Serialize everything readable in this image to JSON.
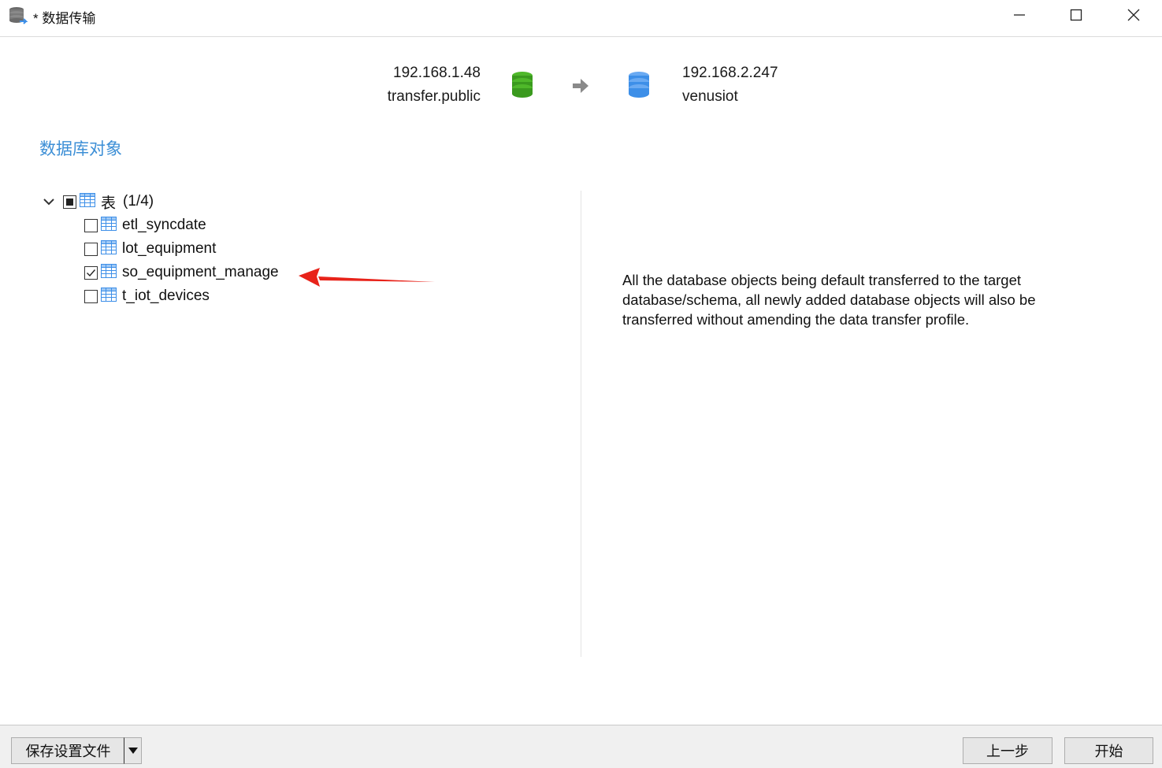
{
  "window": {
    "title": "* 数据传输",
    "app_icon": "database-transfer-icon",
    "controls": [
      "minimize-icon",
      "maximize-icon",
      "close-icon"
    ]
  },
  "connection": {
    "source": {
      "host": "192.168.1.48",
      "schema": "transfer.public",
      "icon": "database-icon",
      "color": "#3a9a1e"
    },
    "arrow_icon": "arrow-right-icon",
    "target": {
      "host": "192.168.2.247",
      "schema": "venusiot",
      "icon": "database-icon",
      "color": "#3d8fe8"
    }
  },
  "section_title": "数据库对象",
  "tree": {
    "root": {
      "label": "表",
      "count": "(1/4)",
      "state": "partial",
      "expanded": true,
      "icon": "table-icon"
    },
    "items": [
      {
        "label": "etl_syncdate",
        "checked": false,
        "icon": "table-icon"
      },
      {
        "label": "lot_equipment",
        "checked": false,
        "icon": "table-icon"
      },
      {
        "label": "so_equipment_manage",
        "checked": true,
        "icon": "table-icon"
      },
      {
        "label": "t_iot_devices",
        "checked": false,
        "icon": "table-icon"
      }
    ]
  },
  "annotation": {
    "icon": "red-arrow-icon",
    "color": "#e8231a"
  },
  "info_text": "All the database objects being default transferred to the target database/schema, all newly added database objects will also be transferred without amending the data transfer profile.",
  "footer": {
    "save_profile_label": "保存设置文件",
    "back_label": "上一步",
    "start_label": "开始"
  },
  "colors": {
    "accent": "#3d8fd6",
    "bottom_bar": "#f0f0f0"
  }
}
